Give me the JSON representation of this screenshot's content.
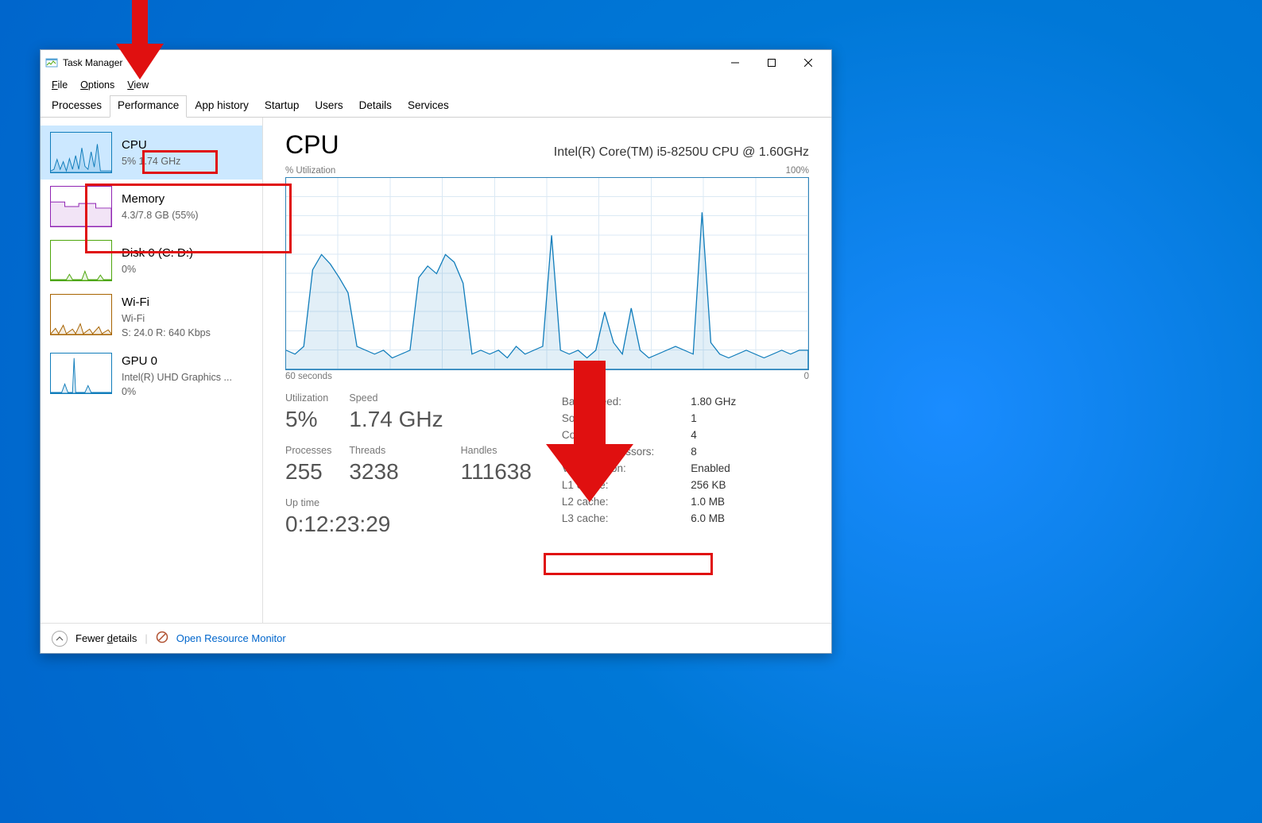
{
  "window": {
    "title": "Task Manager"
  },
  "menubar": [
    "File",
    "Options",
    "View"
  ],
  "tabs": [
    "Processes",
    "Performance",
    "App history",
    "Startup",
    "Users",
    "Details",
    "Services"
  ],
  "sidebar": {
    "items": [
      {
        "title": "CPU",
        "sub1": "5%  1.74 GHz",
        "color": "#117dbb"
      },
      {
        "title": "Memory",
        "sub1": "4.3/7.8 GB (55%)",
        "color": "#9024b3"
      },
      {
        "title": "Disk 0 (C: D:)",
        "sub1": "0%",
        "color": "#4da60c"
      },
      {
        "title": "Wi-Fi",
        "sub1": "Wi-Fi",
        "sub2": "S: 24.0  R: 640 Kbps",
        "color": "#a76300"
      },
      {
        "title": "GPU 0",
        "sub1": "Intel(R) UHD Graphics ...",
        "sub2": "0%",
        "color": "#117dbb"
      }
    ]
  },
  "main": {
    "heading": "CPU",
    "model": "Intel(R) Core(TM) i5-8250U CPU @ 1.60GHz",
    "chart_top_left": "% Utilization",
    "chart_top_right": "100%",
    "chart_bot_left": "60 seconds",
    "chart_bot_right": "0",
    "stats_left": {
      "utilization_lbl": "Utilization",
      "utilization_val": "5%",
      "speed_lbl": "Speed",
      "speed_val": "1.74 GHz",
      "processes_lbl": "Processes",
      "processes_val": "255",
      "threads_lbl": "Threads",
      "threads_val": "3238",
      "handles_lbl": "Handles",
      "handles_val": "111638",
      "uptime_lbl": "Up time",
      "uptime_val": "0:12:23:29"
    },
    "stats_right": [
      {
        "k": "Base speed:",
        "v": "1.80 GHz"
      },
      {
        "k": "Sockets:",
        "v": "1"
      },
      {
        "k": "Cores:",
        "v": "4"
      },
      {
        "k": "Logical processors:",
        "v": "8"
      },
      {
        "k": "Virtualization:",
        "v": "Enabled"
      },
      {
        "k": "L1 cache:",
        "v": "256 KB"
      },
      {
        "k": "L2 cache:",
        "v": "1.0 MB"
      },
      {
        "k": "L3 cache:",
        "v": "6.0 MB"
      }
    ]
  },
  "footer": {
    "fewer": "Fewer details",
    "open": "Open Resource Monitor"
  },
  "chart_data": {
    "type": "line",
    "title": "% Utilization",
    "xlabel": "seconds",
    "ylabel": "% Utilization",
    "x_range": [
      60,
      0
    ],
    "ylim": [
      0,
      100
    ],
    "values": [
      10,
      8,
      12,
      52,
      60,
      55,
      48,
      40,
      12,
      10,
      8,
      10,
      6,
      8,
      10,
      48,
      54,
      50,
      60,
      56,
      45,
      8,
      10,
      8,
      10,
      6,
      12,
      8,
      10,
      12,
      70,
      10,
      8,
      10,
      6,
      10,
      30,
      14,
      8,
      32,
      10,
      6,
      8,
      10,
      12,
      10,
      8,
      82,
      14,
      8,
      6,
      8,
      10,
      8,
      6,
      8,
      10,
      8,
      10,
      10
    ]
  }
}
